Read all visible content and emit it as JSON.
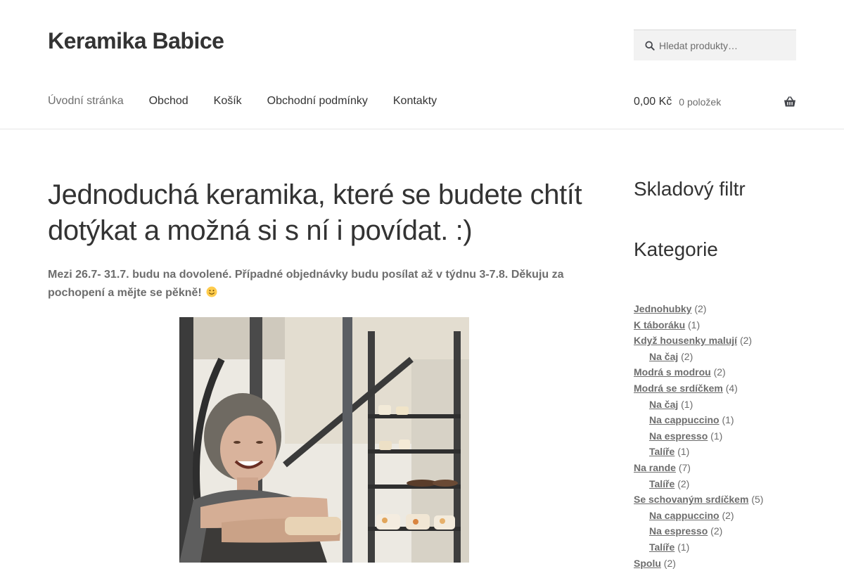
{
  "site": {
    "title": "Keramika Babice"
  },
  "search": {
    "placeholder": "Hledat produkty…"
  },
  "nav": {
    "items": [
      {
        "label": "Úvodní stránka",
        "current": true
      },
      {
        "label": "Obchod"
      },
      {
        "label": "Košík"
      },
      {
        "label": "Obchodní podmínky"
      },
      {
        "label": "Kontakty"
      }
    ]
  },
  "cart": {
    "amount": "0,00 Kč",
    "count": "0 položek"
  },
  "main": {
    "heading": "Jednoduchá keramika, které se budete chtít dotýkat a možná si s ní i povídat. :)",
    "notice": "Mezi 26.7- 31.7. budu na dovolené. Případné objednávky budu posílat až v týdnu 3-7.8. Děkuju za pochopení a mějte se pěkně!"
  },
  "sidebar": {
    "stock_filter_title": "Skladový filtr",
    "categories_title": "Kategorie",
    "categories": [
      {
        "name": "Jednohubky",
        "count": "(2)",
        "level": 0
      },
      {
        "name": "K táboráku",
        "count": "(1)",
        "level": 0
      },
      {
        "name": "Když housenky malují",
        "count": "(2)",
        "level": 0
      },
      {
        "name": "Na čaj",
        "count": "(2)",
        "level": 1
      },
      {
        "name": "Modrá s modrou",
        "count": "(2)",
        "level": 0
      },
      {
        "name": "Modrá se srdíčkem",
        "count": "(4)",
        "level": 0
      },
      {
        "name": "Na čaj",
        "count": "(1)",
        "level": 1
      },
      {
        "name": "Na cappuccino",
        "count": "(1)",
        "level": 1
      },
      {
        "name": "Na espresso",
        "count": "(1)",
        "level": 1
      },
      {
        "name": "Talíře",
        "count": "(1)",
        "level": 1
      },
      {
        "name": "Na rande",
        "count": "(7)",
        "level": 0
      },
      {
        "name": "Talíře",
        "count": "(2)",
        "level": 1
      },
      {
        "name": "Se schovaným srdíčkem",
        "count": "(5)",
        "level": 0
      },
      {
        "name": "Na cappuccino",
        "count": "(2)",
        "level": 1
      },
      {
        "name": "Na espresso",
        "count": "(2)",
        "level": 1
      },
      {
        "name": "Talíře",
        "count": "(1)",
        "level": 1
      },
      {
        "name": "Spolu",
        "count": "(2)",
        "level": 0
      }
    ]
  },
  "icons": {
    "search": "search-icon",
    "cart": "basket-icon",
    "smiley": "smiley-icon"
  }
}
